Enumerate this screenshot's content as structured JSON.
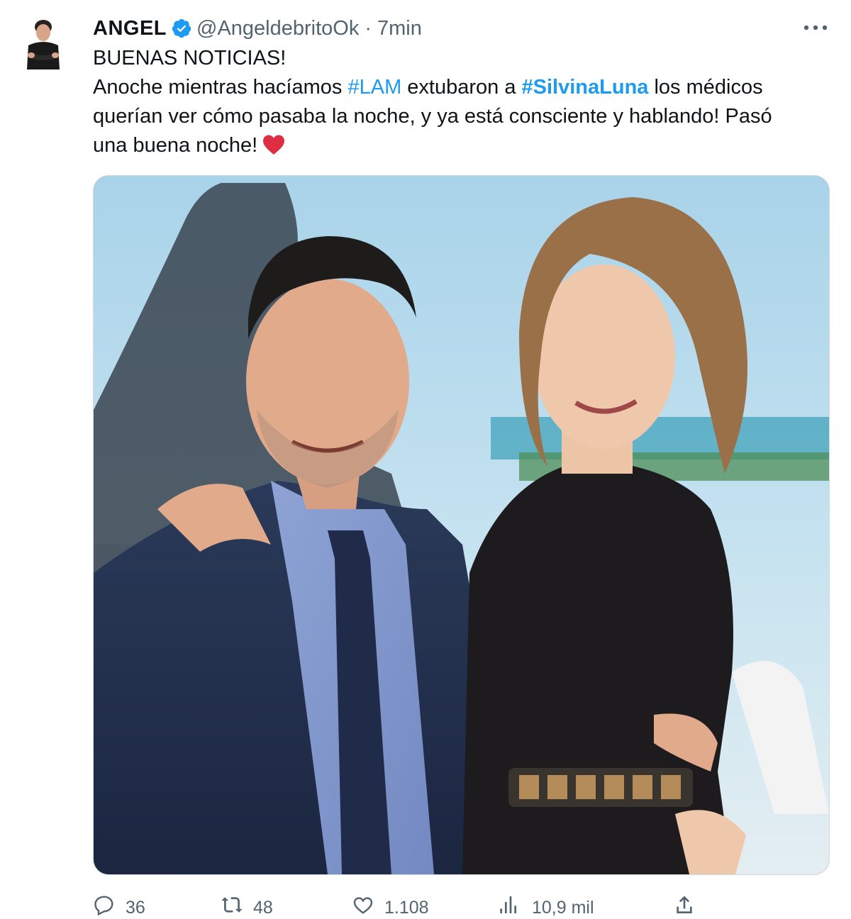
{
  "author": {
    "display_name": "ANGEL",
    "verified": true,
    "handle": "@AngeldebritoOk",
    "separator": "·",
    "time": "7min",
    "avatar_icon": "profile-avatar",
    "more_icon": "more-horizontal-icon"
  },
  "tweet": {
    "line1": "BUENAS NOTICIAS!",
    "line2_part1": "Anoche mientras hacíamos ",
    "hashtag1": "#LAM",
    "line2_part2": " extubaron a ",
    "hashtag2": "#SilvinaLuna",
    "line2_part3": " los médicos",
    "line3": "querían ver cómo pasaba la noche, y ya está consciente y hablando! Pasó",
    "line4": "una buena noche!",
    "emoji": "red-heart"
  },
  "media": {
    "alt": "photo"
  },
  "actions": {
    "reply_count": "36",
    "retweet_count": "48",
    "like_count": "1.108",
    "views_count": "10,9 mil",
    "reply_icon": "reply-icon",
    "retweet_icon": "retweet-icon",
    "like_icon": "heart-icon",
    "views_icon": "views-icon",
    "share_icon": "share-icon"
  },
  "colors": {
    "link": "#1d9bf0",
    "text": "#0f1419",
    "secondary": "#536471",
    "verified": "#1d9bf0",
    "heart": "#e0245e"
  }
}
